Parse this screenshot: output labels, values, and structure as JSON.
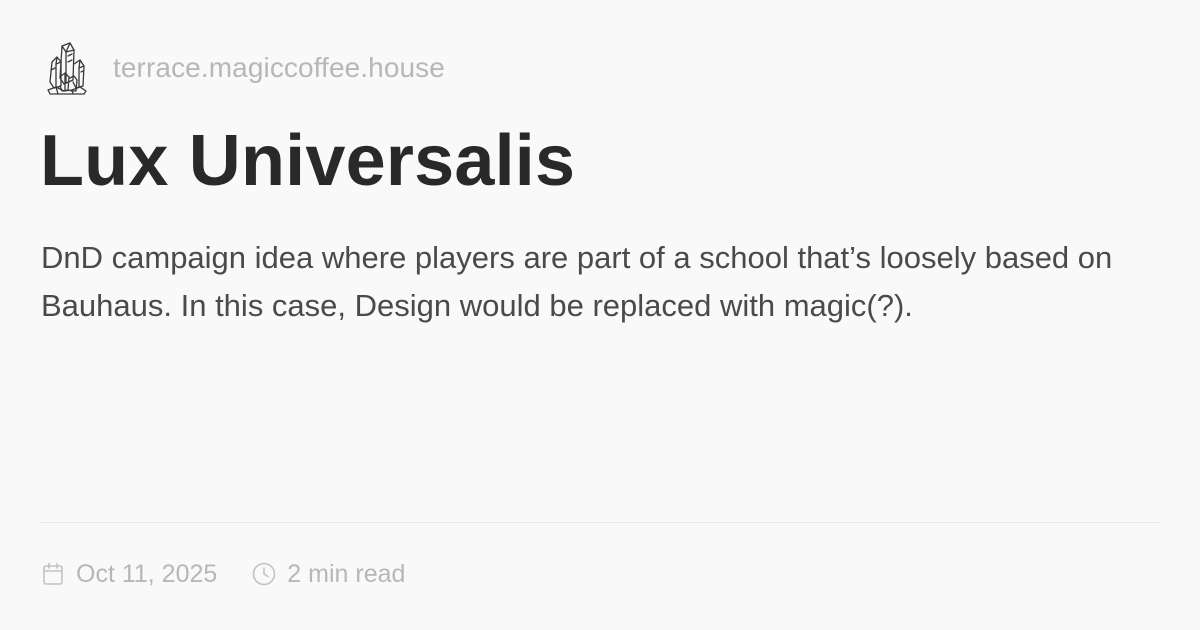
{
  "site": {
    "logo_icon": "crystal-cluster-icon",
    "name": "terrace.magiccoffee.house"
  },
  "post": {
    "title": "Lux Universalis",
    "description": "DnD campaign idea where players are part of a school that’s loosely based on Bauhaus. In this case, Design would be replaced with magic(?)."
  },
  "meta": {
    "date_icon": "calendar-icon",
    "date": "Oct 11, 2025",
    "read_icon": "clock-icon",
    "read_time": "2 min read"
  },
  "colors": {
    "background": "#faf9fa",
    "title": "#2a2829",
    "body_text": "#4b494a",
    "muted_text": "#b8b6b8"
  }
}
